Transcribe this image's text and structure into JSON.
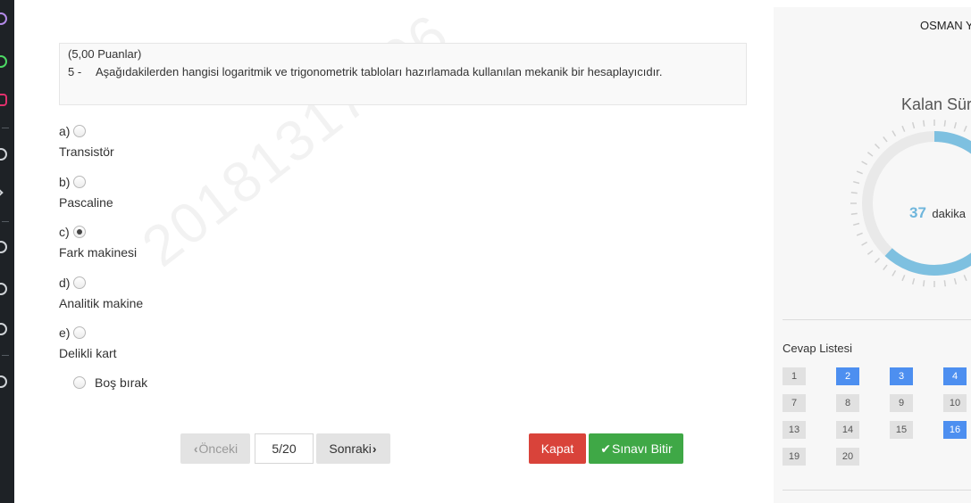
{
  "watermark": "20181317106",
  "question": {
    "points": "(5,00 Puanlar)",
    "number": "5 -",
    "text": "Aşağıdakilerden hangisi logaritmik ve trigonometrik tabloları hazırlamada kullanılan mekanik bir hesaplayıcıdır."
  },
  "options": [
    {
      "letter": "a)",
      "text": "Transistör",
      "checked": false
    },
    {
      "letter": "b)",
      "text": "Pascaline",
      "checked": false
    },
    {
      "letter": "c)",
      "text": "Fark makinesi",
      "checked": true
    },
    {
      "letter": "d)",
      "text": "Analitik makine",
      "checked": false
    },
    {
      "letter": "e)",
      "text": "Delikli kart",
      "checked": false
    }
  ],
  "blank_option": "Boş bırak",
  "nav": {
    "prev_label": "Önceki",
    "page_value": "5/20",
    "next_label": "Sonraki",
    "close_label": "Kapat",
    "finish_label": "Sınavı Bitir"
  },
  "panel": {
    "student_name": "OSMAN Y",
    "remaining_label": "Kalan Süre",
    "timer_value": "37",
    "timer_unit": "dakika",
    "timer_fraction": 0.62,
    "answers_title": "Cevap Listesi",
    "answers": [
      {
        "n": "1",
        "answered": false
      },
      {
        "n": "2",
        "answered": true
      },
      {
        "n": "3",
        "answered": true
      },
      {
        "n": "4",
        "answered": true
      },
      {
        "n": "7",
        "answered": false
      },
      {
        "n": "8",
        "answered": false
      },
      {
        "n": "9",
        "answered": false
      },
      {
        "n": "10",
        "answered": false
      },
      {
        "n": "13",
        "answered": false
      },
      {
        "n": "14",
        "answered": false
      },
      {
        "n": "15",
        "answered": false
      },
      {
        "n": "16",
        "answered": true
      },
      {
        "n": "19",
        "answered": false
      },
      {
        "n": "20",
        "answered": false
      }
    ]
  },
  "colors": {
    "answered": "#4d8ff0",
    "timer_arc": "#7ec0e0",
    "close_button": "#d9433a",
    "finish_button": "#3fa846"
  }
}
